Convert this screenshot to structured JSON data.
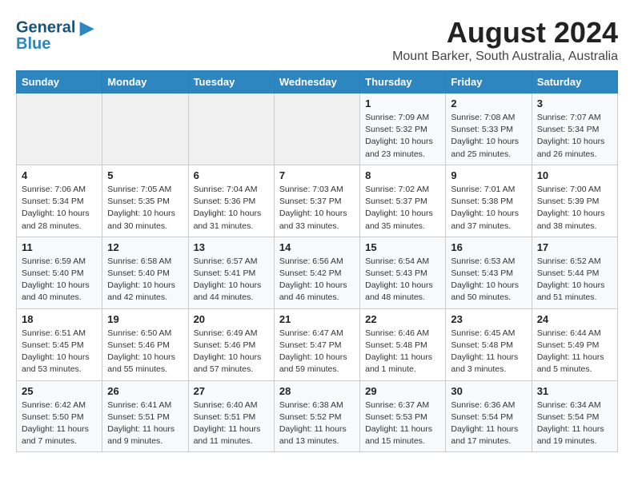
{
  "logo": {
    "line1": "General",
    "line2": "Blue"
  },
  "title": "August 2024",
  "subtitle": "Mount Barker, South Australia, Australia",
  "days_header": [
    "Sunday",
    "Monday",
    "Tuesday",
    "Wednesday",
    "Thursday",
    "Friday",
    "Saturday"
  ],
  "weeks": [
    [
      {
        "num": "",
        "info": ""
      },
      {
        "num": "",
        "info": ""
      },
      {
        "num": "",
        "info": ""
      },
      {
        "num": "",
        "info": ""
      },
      {
        "num": "1",
        "info": "Sunrise: 7:09 AM\nSunset: 5:32 PM\nDaylight: 10 hours\nand 23 minutes."
      },
      {
        "num": "2",
        "info": "Sunrise: 7:08 AM\nSunset: 5:33 PM\nDaylight: 10 hours\nand 25 minutes."
      },
      {
        "num": "3",
        "info": "Sunrise: 7:07 AM\nSunset: 5:34 PM\nDaylight: 10 hours\nand 26 minutes."
      }
    ],
    [
      {
        "num": "4",
        "info": "Sunrise: 7:06 AM\nSunset: 5:34 PM\nDaylight: 10 hours\nand 28 minutes."
      },
      {
        "num": "5",
        "info": "Sunrise: 7:05 AM\nSunset: 5:35 PM\nDaylight: 10 hours\nand 30 minutes."
      },
      {
        "num": "6",
        "info": "Sunrise: 7:04 AM\nSunset: 5:36 PM\nDaylight: 10 hours\nand 31 minutes."
      },
      {
        "num": "7",
        "info": "Sunrise: 7:03 AM\nSunset: 5:37 PM\nDaylight: 10 hours\nand 33 minutes."
      },
      {
        "num": "8",
        "info": "Sunrise: 7:02 AM\nSunset: 5:37 PM\nDaylight: 10 hours\nand 35 minutes."
      },
      {
        "num": "9",
        "info": "Sunrise: 7:01 AM\nSunset: 5:38 PM\nDaylight: 10 hours\nand 37 minutes."
      },
      {
        "num": "10",
        "info": "Sunrise: 7:00 AM\nSunset: 5:39 PM\nDaylight: 10 hours\nand 38 minutes."
      }
    ],
    [
      {
        "num": "11",
        "info": "Sunrise: 6:59 AM\nSunset: 5:40 PM\nDaylight: 10 hours\nand 40 minutes."
      },
      {
        "num": "12",
        "info": "Sunrise: 6:58 AM\nSunset: 5:40 PM\nDaylight: 10 hours\nand 42 minutes."
      },
      {
        "num": "13",
        "info": "Sunrise: 6:57 AM\nSunset: 5:41 PM\nDaylight: 10 hours\nand 44 minutes."
      },
      {
        "num": "14",
        "info": "Sunrise: 6:56 AM\nSunset: 5:42 PM\nDaylight: 10 hours\nand 46 minutes."
      },
      {
        "num": "15",
        "info": "Sunrise: 6:54 AM\nSunset: 5:43 PM\nDaylight: 10 hours\nand 48 minutes."
      },
      {
        "num": "16",
        "info": "Sunrise: 6:53 AM\nSunset: 5:43 PM\nDaylight: 10 hours\nand 50 minutes."
      },
      {
        "num": "17",
        "info": "Sunrise: 6:52 AM\nSunset: 5:44 PM\nDaylight: 10 hours\nand 51 minutes."
      }
    ],
    [
      {
        "num": "18",
        "info": "Sunrise: 6:51 AM\nSunset: 5:45 PM\nDaylight: 10 hours\nand 53 minutes."
      },
      {
        "num": "19",
        "info": "Sunrise: 6:50 AM\nSunset: 5:46 PM\nDaylight: 10 hours\nand 55 minutes."
      },
      {
        "num": "20",
        "info": "Sunrise: 6:49 AM\nSunset: 5:46 PM\nDaylight: 10 hours\nand 57 minutes."
      },
      {
        "num": "21",
        "info": "Sunrise: 6:47 AM\nSunset: 5:47 PM\nDaylight: 10 hours\nand 59 minutes."
      },
      {
        "num": "22",
        "info": "Sunrise: 6:46 AM\nSunset: 5:48 PM\nDaylight: 11 hours\nand 1 minute."
      },
      {
        "num": "23",
        "info": "Sunrise: 6:45 AM\nSunset: 5:48 PM\nDaylight: 11 hours\nand 3 minutes."
      },
      {
        "num": "24",
        "info": "Sunrise: 6:44 AM\nSunset: 5:49 PM\nDaylight: 11 hours\nand 5 minutes."
      }
    ],
    [
      {
        "num": "25",
        "info": "Sunrise: 6:42 AM\nSunset: 5:50 PM\nDaylight: 11 hours\nand 7 minutes."
      },
      {
        "num": "26",
        "info": "Sunrise: 6:41 AM\nSunset: 5:51 PM\nDaylight: 11 hours\nand 9 minutes."
      },
      {
        "num": "27",
        "info": "Sunrise: 6:40 AM\nSunset: 5:51 PM\nDaylight: 11 hours\nand 11 minutes."
      },
      {
        "num": "28",
        "info": "Sunrise: 6:38 AM\nSunset: 5:52 PM\nDaylight: 11 hours\nand 13 minutes."
      },
      {
        "num": "29",
        "info": "Sunrise: 6:37 AM\nSunset: 5:53 PM\nDaylight: 11 hours\nand 15 minutes."
      },
      {
        "num": "30",
        "info": "Sunrise: 6:36 AM\nSunset: 5:54 PM\nDaylight: 11 hours\nand 17 minutes."
      },
      {
        "num": "31",
        "info": "Sunrise: 6:34 AM\nSunset: 5:54 PM\nDaylight: 11 hours\nand 19 minutes."
      }
    ]
  ]
}
